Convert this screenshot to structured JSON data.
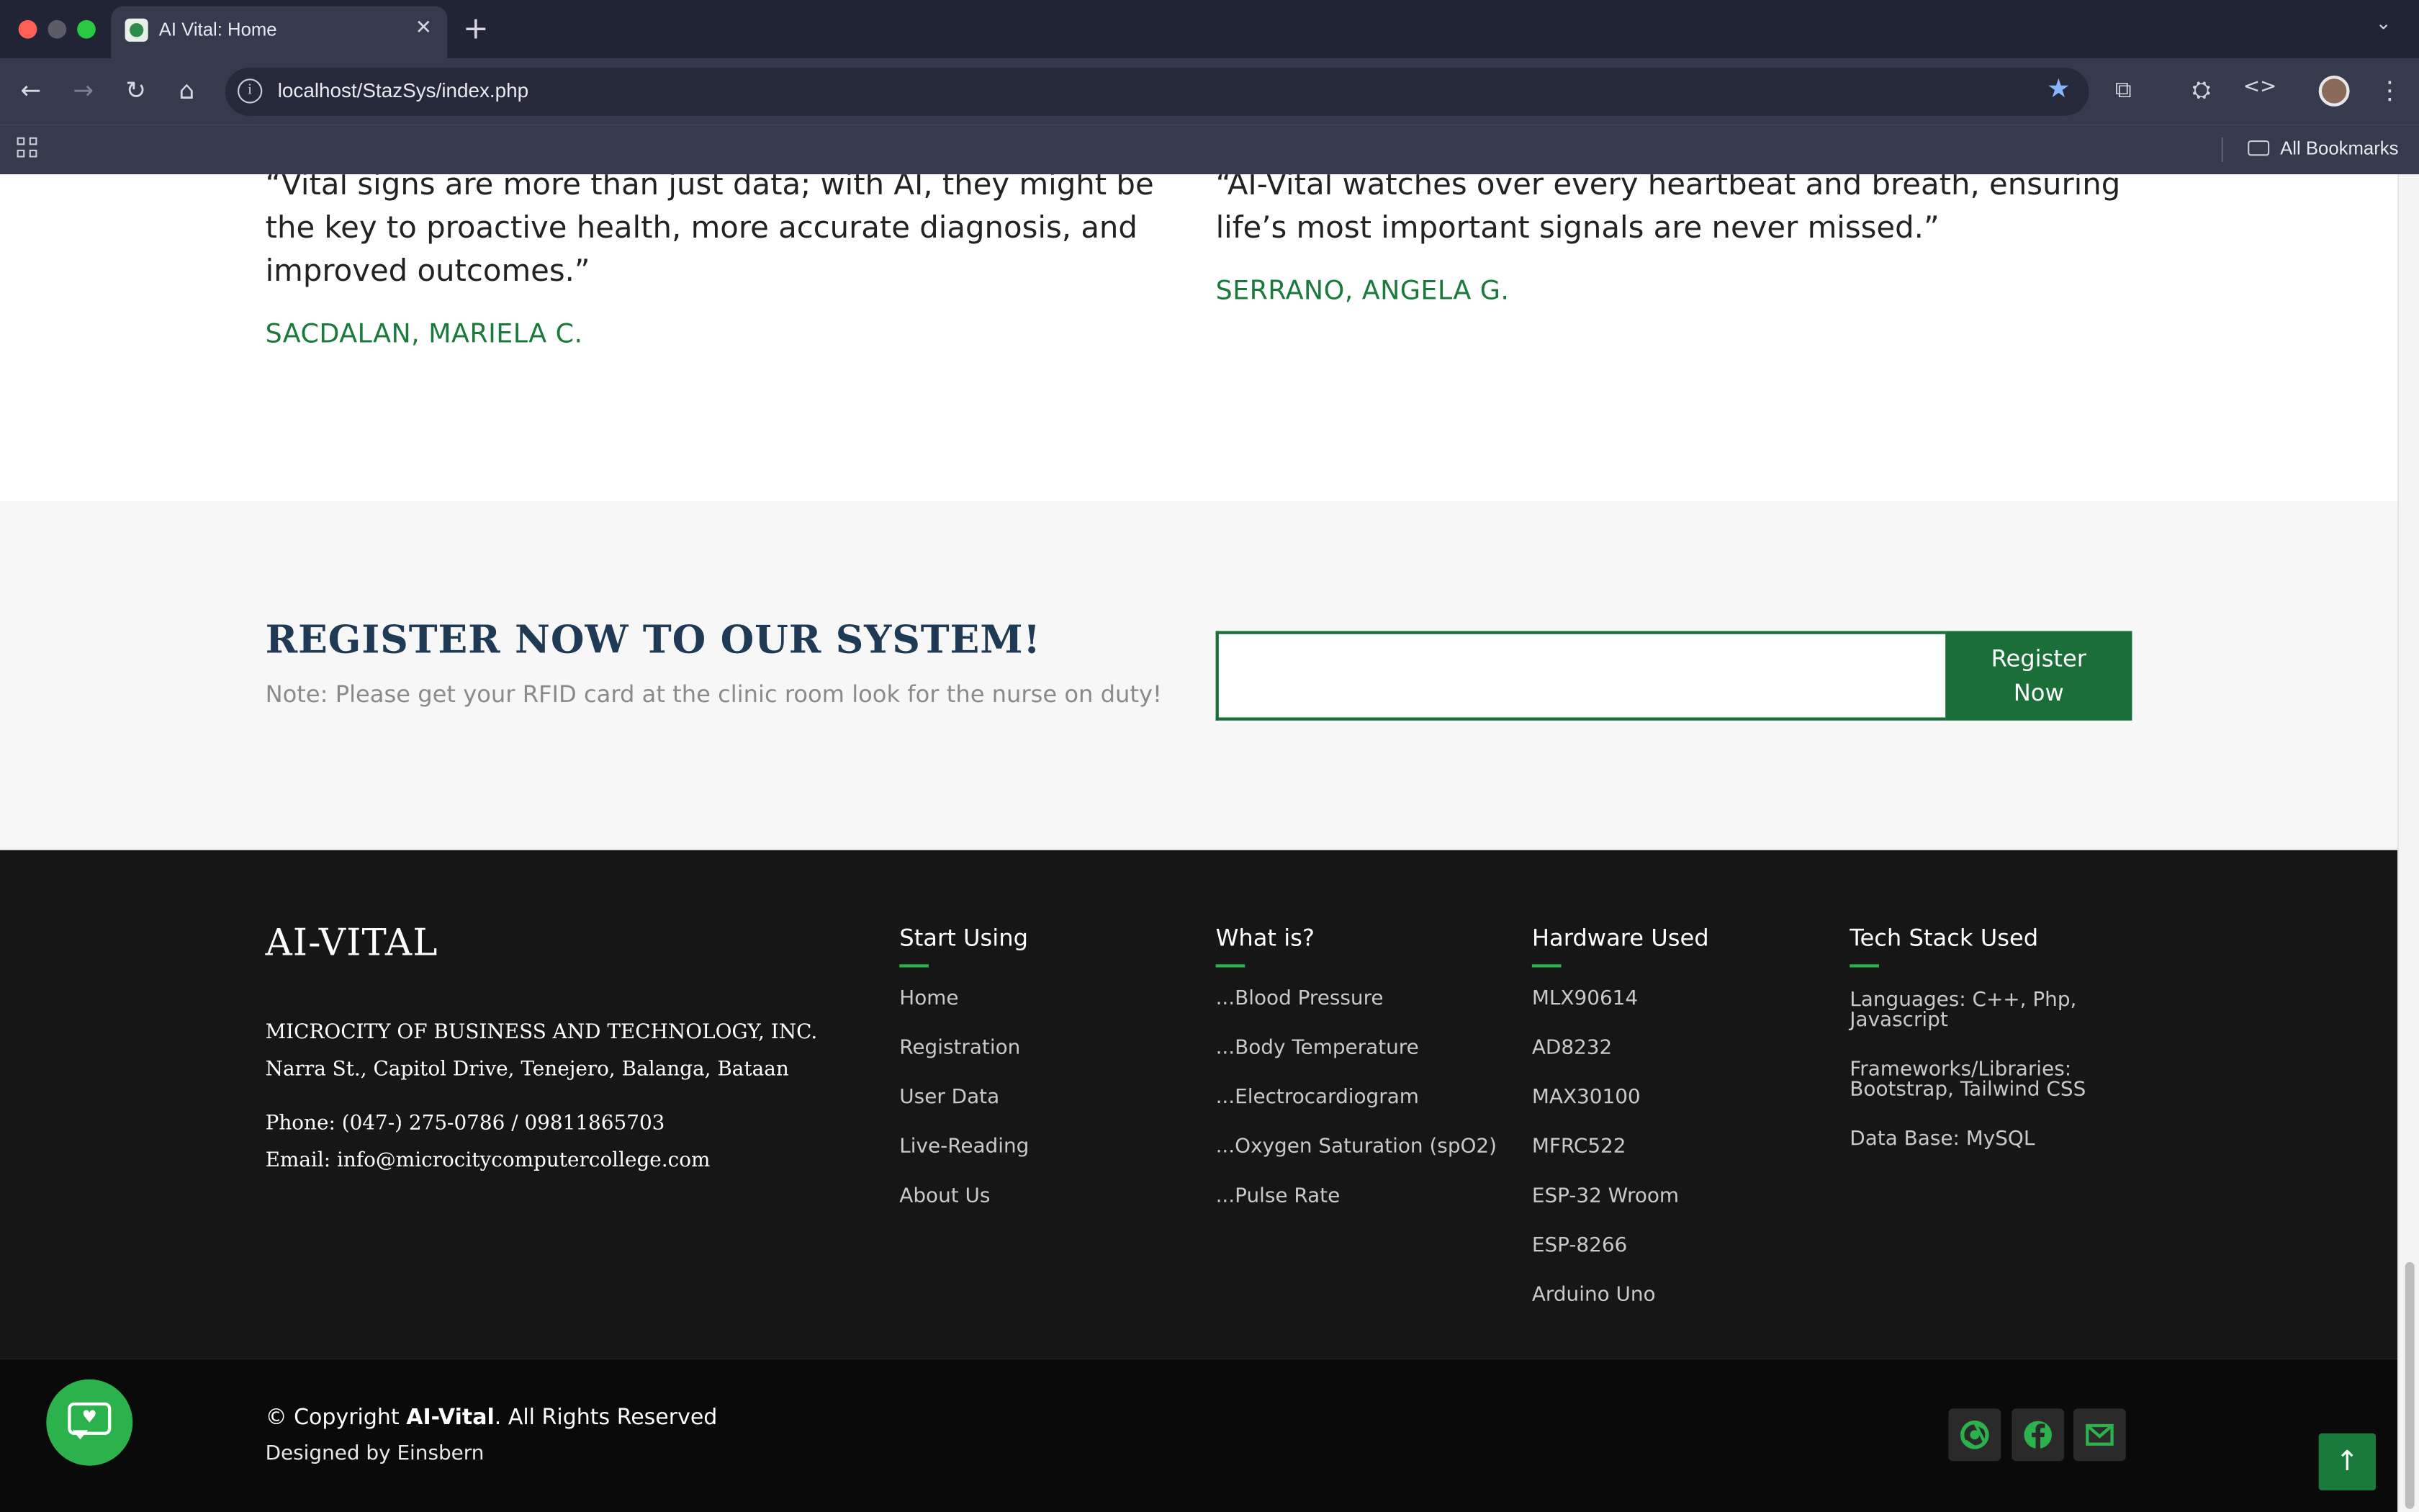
{
  "browser": {
    "tab_title": "AI Vital: Home",
    "tab_close": "✕",
    "new_tab": "+",
    "url": "localhost/StazSys/index.php",
    "bookmarks_label": "All Bookmarks"
  },
  "testimonials": [
    {
      "quote": "“Vital signs are more than just data; with AI, they might be the key to proactive health, more accurate diagnosis, and improved outcomes.”",
      "author": "SACDALAN, MARIELA C."
    },
    {
      "quote": "“AI-Vital watches over every heartbeat and breath, ensuring life’s most important signals are never missed.”",
      "author": "SERRANO, ANGELA G."
    }
  ],
  "register": {
    "title": "REGISTER NOW TO OUR SYSTEM!",
    "note": "Note: Please get your RFID card at the clinic room look for the nurse on duty!",
    "input_value": "",
    "button_line1": "Register",
    "button_line2": "Now"
  },
  "footer": {
    "brand": "AI-VITAL",
    "company": "MICROCITY OF BUSINESS AND TECHNOLOGY, INC.",
    "address": "Narra St., Capitol Drive, Tenejero, Balanga, Bataan",
    "phone": "Phone: (047-) 275-0786 / 09811865703",
    "email": "Email: info@microcitycomputercollege.com",
    "columns": [
      {
        "title": "Start Using",
        "items": [
          "Home",
          "Registration",
          "User Data",
          "Live-Reading",
          "About Us"
        ]
      },
      {
        "title": "What is?",
        "items": [
          "...Blood Pressure",
          "...Body Temperature",
          "...Electrocardiogram",
          "...Oxygen Saturation (spO2)",
          "...Pulse Rate"
        ]
      },
      {
        "title": "Hardware Used",
        "items": [
          "MLX90614",
          "AD8232",
          "MAX30100",
          "MFRC522",
          "ESP-32 Wroom",
          "ESP-8266",
          "Arduino Uno"
        ]
      },
      {
        "title": "Tech Stack Used",
        "items": [
          "Languages: C++, Php, Javascript",
          "Frameworks/Libraries: Bootstrap, Tailwind CSS",
          "Data Base: MySQL"
        ]
      }
    ]
  },
  "bottom": {
    "copyright_prefix": "© Copyright ",
    "copyright_brand": "AI-Vital",
    "copyright_suffix": ". All Rights Reserved",
    "designed_by": "Designed by Einsbern"
  },
  "colors": {
    "brand_green": "#1a6e38",
    "accent_green": "#2bb24c",
    "footer_bg": "#161616"
  },
  "icons": [
    "back-icon",
    "forward-icon",
    "reload-icon",
    "home-icon",
    "info-icon",
    "star-icon",
    "extensions-icon",
    "incognito-icon",
    "devtools-icon",
    "menu-icon",
    "apps-icon",
    "folder-icon",
    "chrome-icon",
    "facebook-icon",
    "mail-icon",
    "chat-icon",
    "arrow-up-icon"
  ]
}
